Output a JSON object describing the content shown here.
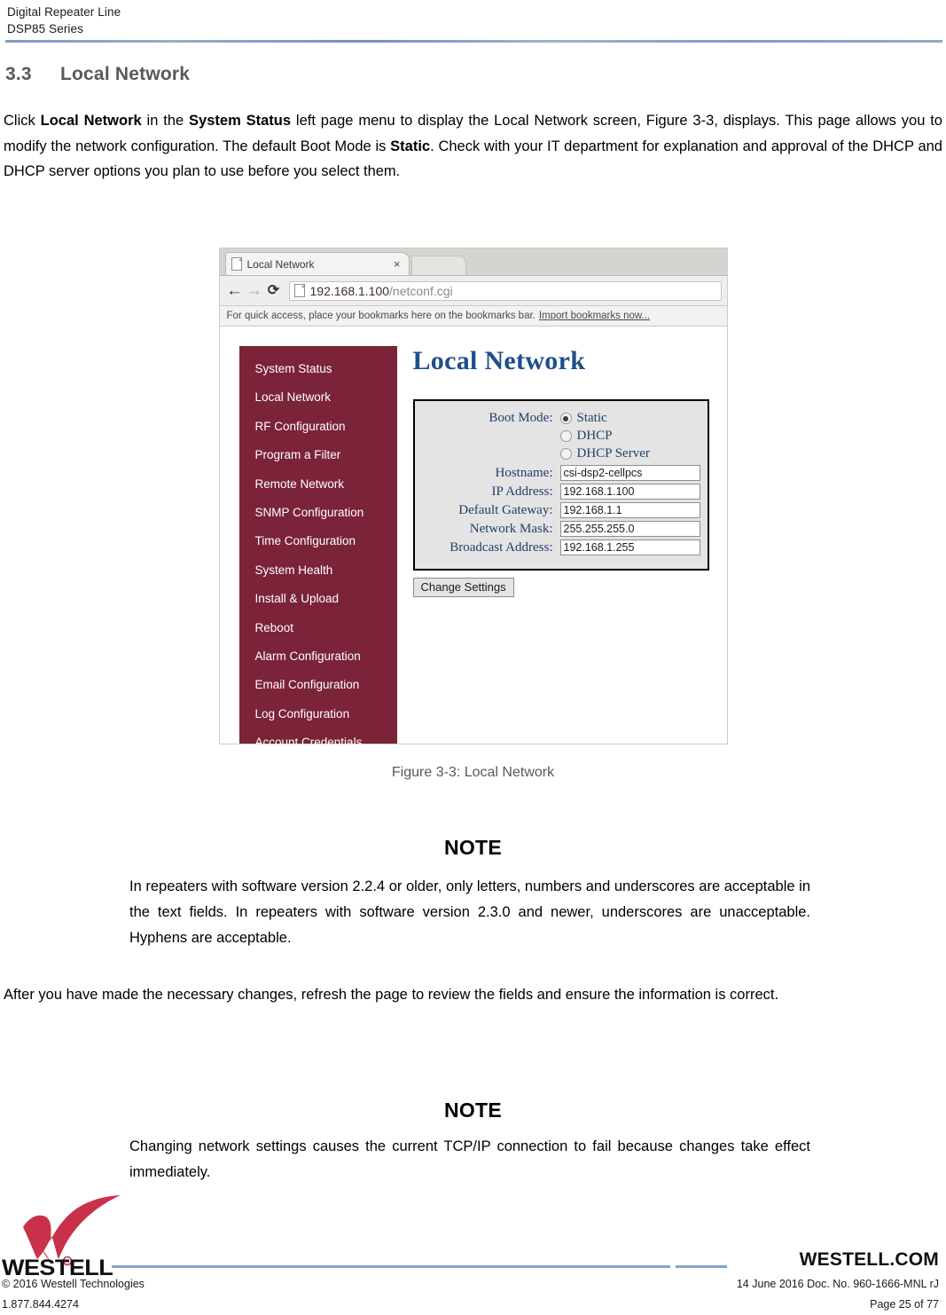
{
  "header": {
    "line1": "Digital Repeater Line",
    "line2": "DSP85 Series"
  },
  "section": {
    "number": "3.3",
    "title": "Local Network"
  },
  "intro": {
    "part1": "Click ",
    "bold1": "Local Network",
    "part2": " in the ",
    "bold2": "System Status",
    "part3": " left page menu to display the Local Network screen, Figure 3-3, displays. This page allows you to modify the network configuration.  The default Boot Mode is ",
    "bold3": "Static",
    "part4": ".  Check with your IT department for explanation and approval of the DHCP and DHCP server options you plan to use before you select them."
  },
  "browser": {
    "tab_title": "Local Network",
    "tab_close": "×",
    "back_icon": "←",
    "forward_icon": "→",
    "reload_icon": "⟳",
    "url_host": "192.168.1.100",
    "url_path": "/netconf.cgi",
    "bookmarks_text": "For quick access, place your bookmarks here on the bookmarks bar.",
    "bookmarks_link": "Import bookmarks now..."
  },
  "webui": {
    "page_title": "Local Network",
    "sidebar": [
      "System Status",
      "Local Network",
      "RF Configuration",
      "Program a Filter",
      "Remote Network",
      "SNMP Configuration",
      "Time Configuration",
      "System Health",
      "Install & Upload",
      "Reboot",
      "Alarm Configuration",
      "Email Configuration",
      "Log Configuration",
      "Account Credentials"
    ],
    "boot_mode_label": "Boot Mode:",
    "boot_modes": [
      {
        "label": "Static",
        "selected": true
      },
      {
        "label": "DHCP",
        "selected": false
      },
      {
        "label": "DHCP Server",
        "selected": false
      }
    ],
    "fields": [
      {
        "label": "Hostname:",
        "value": "csi-dsp2-cellpcs"
      },
      {
        "label": "IP Address:",
        "value": "192.168.1.100"
      },
      {
        "label": "Default Gateway:",
        "value": "192.168.1.1"
      },
      {
        "label": "Network Mask:",
        "value": "255.255.255.0"
      },
      {
        "label": "Broadcast Address:",
        "value": "192.168.1.255"
      }
    ],
    "submit_label": "Change Settings",
    "sidebar_color": "#7a2339",
    "title_color": "#1f4e8c"
  },
  "figure_caption": "Figure 3-3: Local Network",
  "note1": {
    "title": "NOTE",
    "body": "In repeaters with software version 2.2.4 or older, only letters, numbers and underscores are acceptable in the text fields.  In repeaters with software version 2.3.0 and newer, underscores are unacceptable. Hyphens are acceptable."
  },
  "mid_paragraph": "After you have made the necessary changes, refresh the page to review the fields and ensure the information is correct.",
  "note2": {
    "title": "NOTE",
    "body": "Changing network settings causes the current TCP/IP connection to fail because changes take effect immediately."
  },
  "footer": {
    "logo_word": "WESTELL",
    "site": "WESTELL.COM",
    "copyright": "© 2016 Westell Technologies",
    "phone": "1.877.844.4274",
    "doc": "14 June 2016 Doc. No. 960-1666-MNL rJ",
    "page": "Page 25 of 77",
    "accent": "#85a4c4",
    "logo_red": "#c9314a"
  }
}
